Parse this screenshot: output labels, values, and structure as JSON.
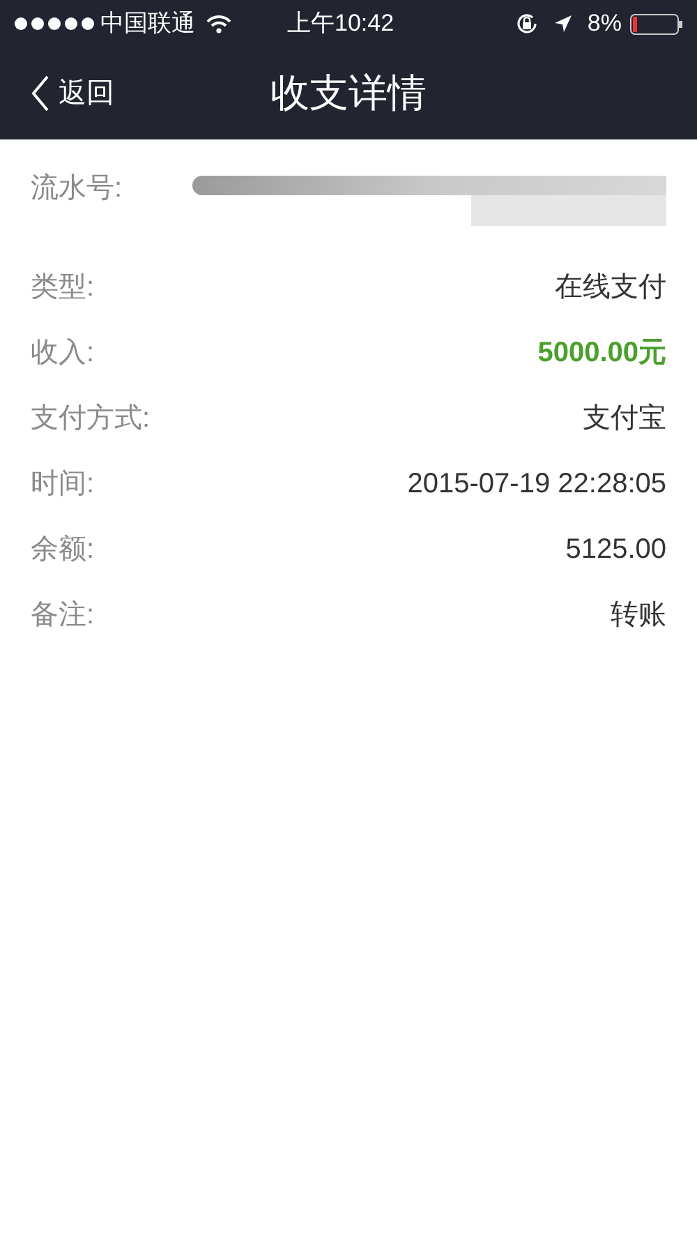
{
  "status_bar": {
    "carrier": "中国联通",
    "time": "上午10:42",
    "battery": "8%"
  },
  "nav": {
    "back": "返回",
    "title": "收支详情"
  },
  "rows": [
    {
      "kind": "redacted",
      "label": "流水号:"
    },
    {
      "kind": "text",
      "label": "类型:",
      "value": "在线支付"
    },
    {
      "kind": "amount",
      "label": "收入:",
      "value": "5000.00元"
    },
    {
      "kind": "text",
      "label": "支付方式:",
      "value": "支付宝"
    },
    {
      "kind": "text",
      "label": "时间:",
      "value": "2015-07-19 22:28:05"
    },
    {
      "kind": "text",
      "label": "余额:",
      "value": "5125.00"
    },
    {
      "kind": "text",
      "label": "备注:",
      "value": "转账"
    }
  ]
}
